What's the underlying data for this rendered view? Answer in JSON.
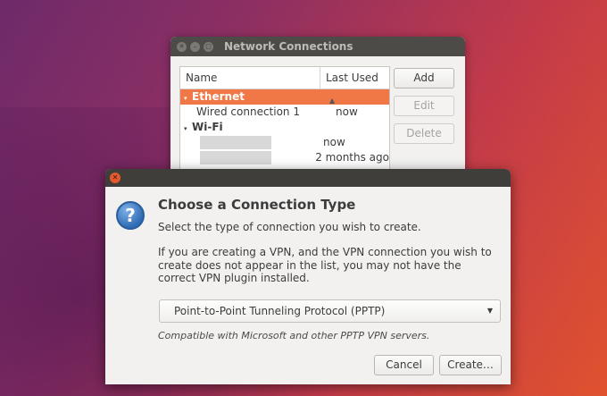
{
  "network_window": {
    "title": "Network Connections",
    "columns": {
      "name": "Name",
      "last_used": "Last Used"
    },
    "rows": [
      {
        "name": "Ethernet",
        "last_used": "",
        "type": "group"
      },
      {
        "name": "Wired connection 1",
        "last_used": "now",
        "type": "child"
      },
      {
        "name": "Wi-Fi",
        "last_used": "",
        "type": "group"
      },
      {
        "name": "",
        "last_used": "now",
        "type": "child-redacted"
      },
      {
        "name": "",
        "last_used": "2 months ago",
        "type": "child-redacted"
      }
    ],
    "buttons": {
      "add": "Add",
      "edit": "Edit",
      "delete": "Delete"
    }
  },
  "dialog": {
    "heading": "Choose a Connection Type",
    "intro": "Select the type of connection you wish to create.",
    "info": "If you are creating a VPN, and the VPN connection you wish to create does not appear in the list, you may not have the correct VPN plugin installed.",
    "select_value": "Point-to-Point Tunneling Protocol (PPTP)",
    "note": "Compatible with Microsoft and other PPTP VPN servers.",
    "cancel_label": "Cancel",
    "create_label": "Create…"
  },
  "icons": {
    "window_close": "close-icon",
    "window_minimize": "minimize-icon",
    "window_maximize": "maximize-icon",
    "question": "question-icon",
    "dropdown": "chevron-down-icon",
    "sort": "sort-asc-icon"
  },
  "colors": {
    "selection": "#f07746",
    "close": "#e65a2f"
  }
}
